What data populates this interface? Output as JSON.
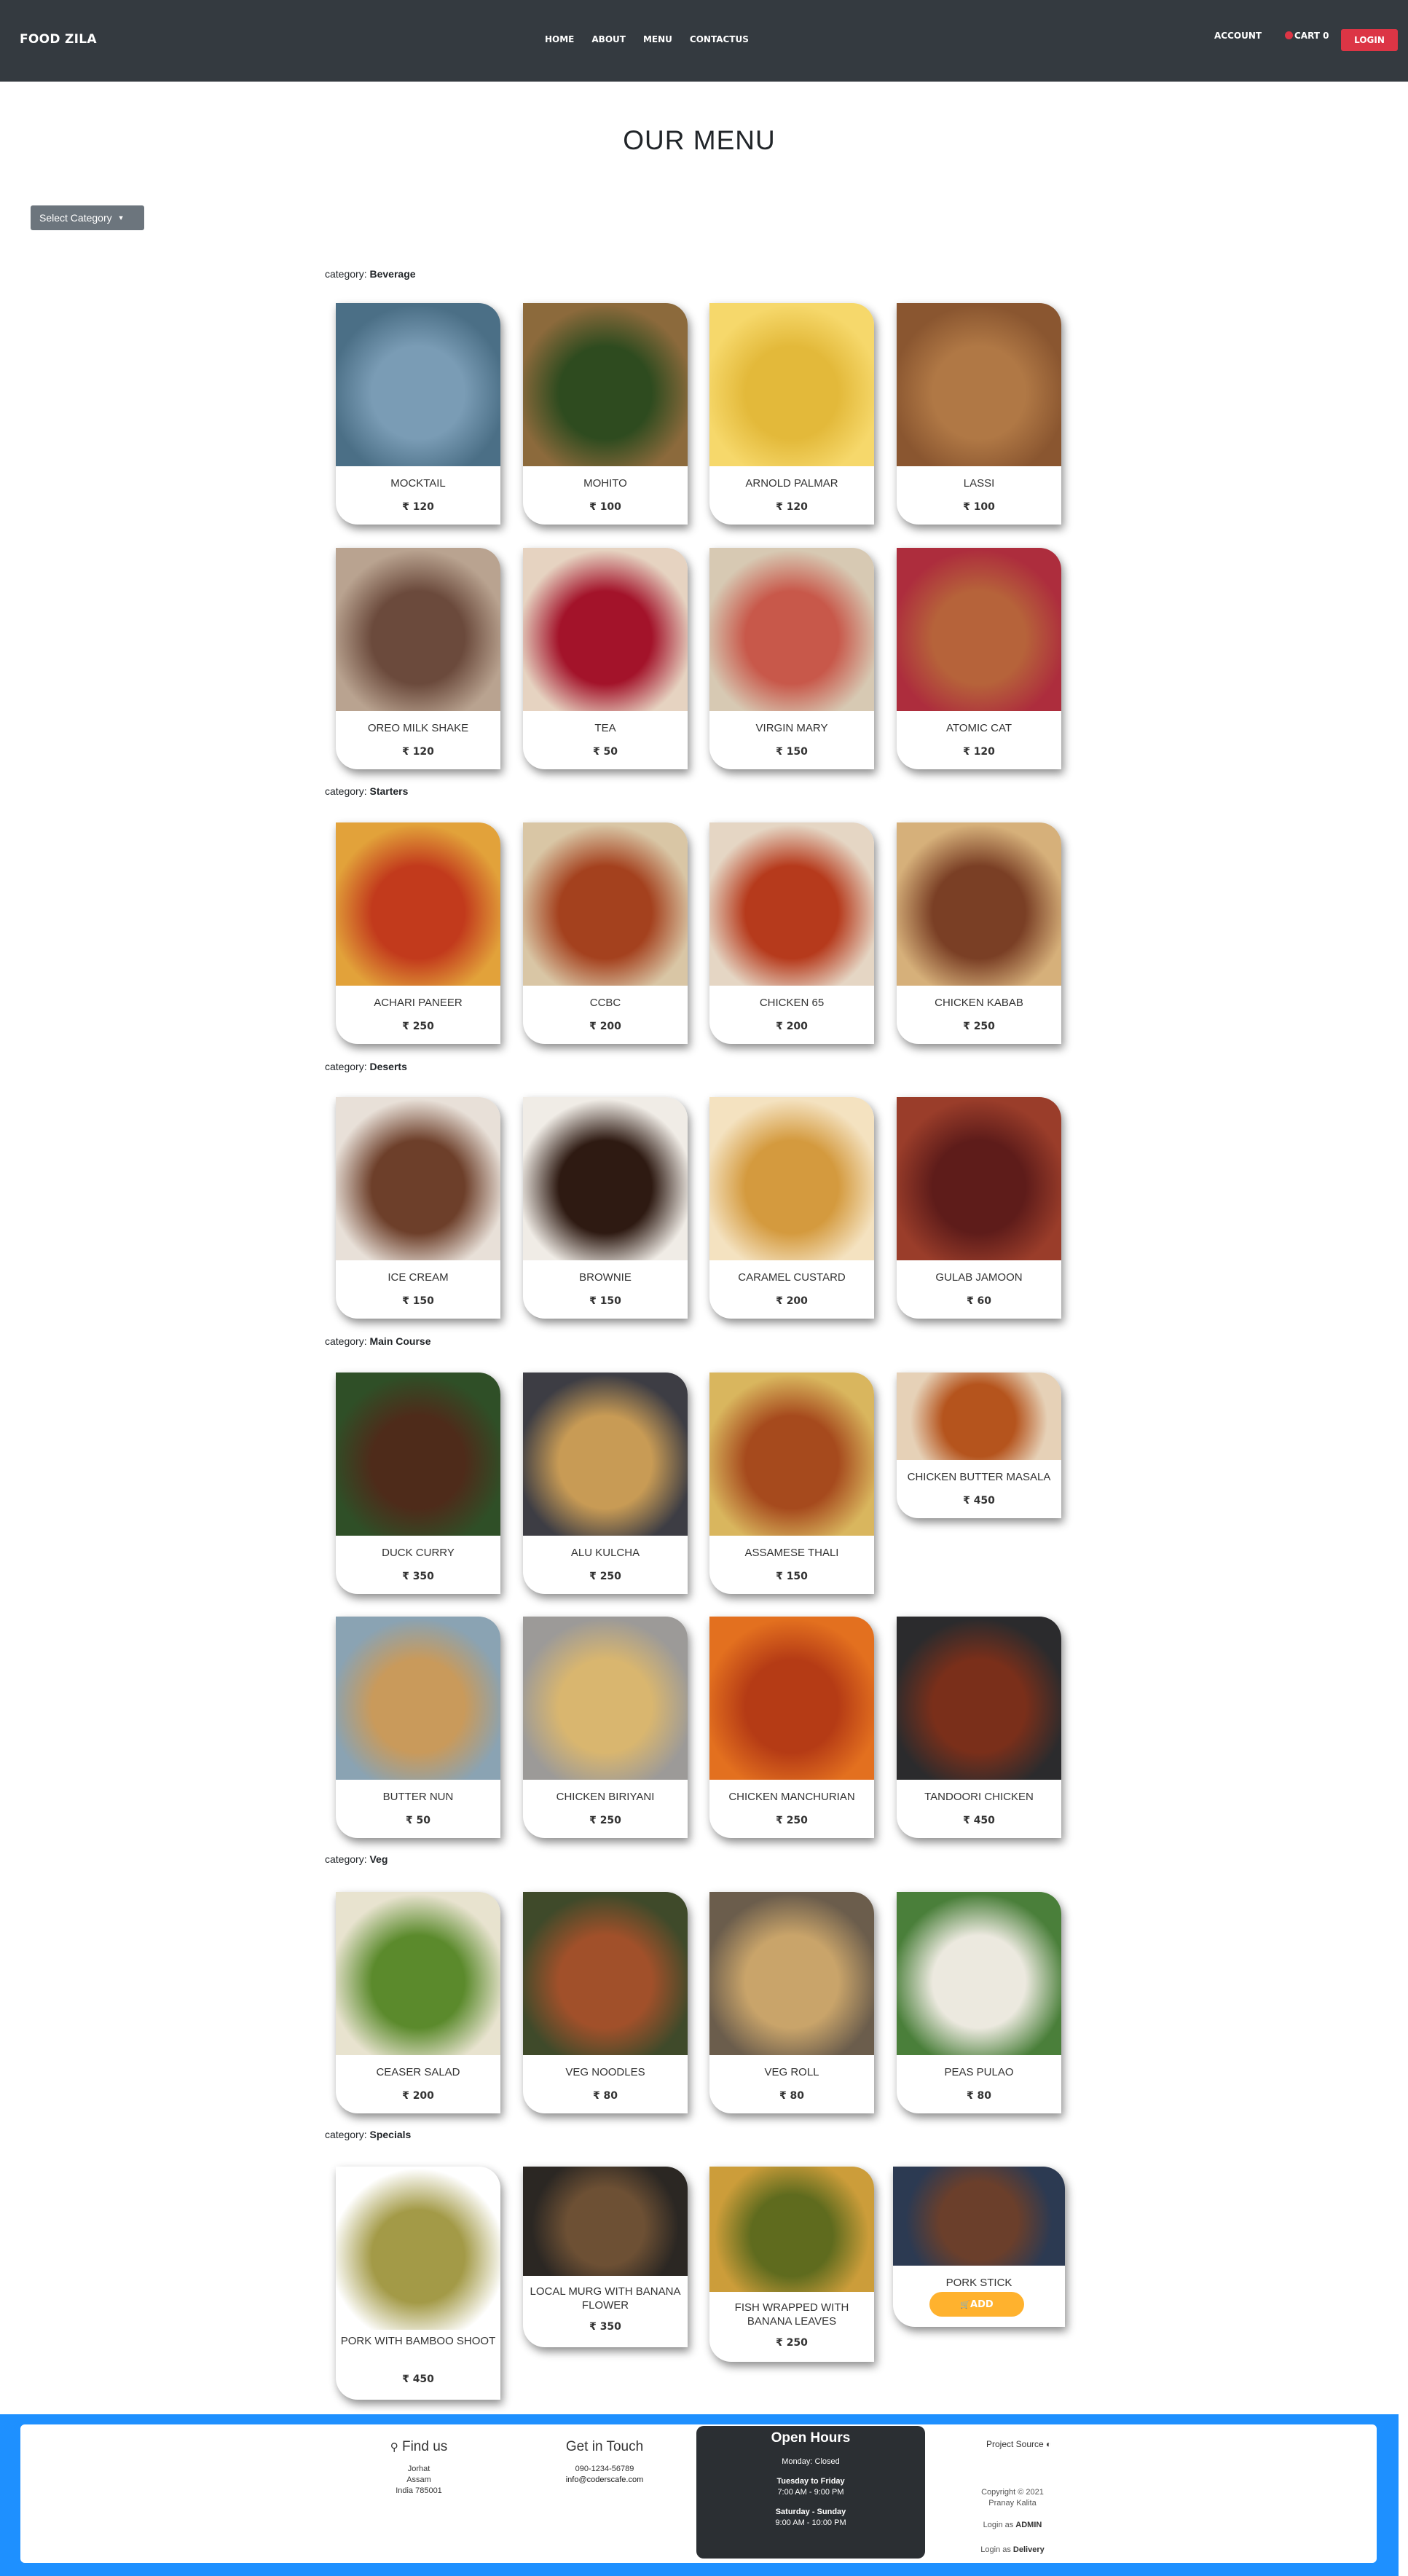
{
  "nav": {
    "brand": "FOOD ZILA",
    "links": [
      "HOME",
      "ABOUT",
      "MENU",
      "CONTACTUS"
    ],
    "account": "ACCOUNT",
    "cart": "CART 0",
    "login": "LOGIN"
  },
  "page_title": "OUR MENU",
  "select_category": "Select Category",
  "category_prefix": "category:",
  "categories": [
    {
      "name": "Beverage",
      "items": [
        {
          "name": "MOCKTAIL",
          "price": "₹ 120"
        },
        {
          "name": "MOHITO",
          "price": "₹ 100"
        },
        {
          "name": "ARNOLD PALMAR",
          "price": "₹ 120"
        },
        {
          "name": "LASSI",
          "price": "₹ 100"
        },
        {
          "name": "OREO MILK SHAKE",
          "price": "₹ 120"
        },
        {
          "name": "TEA",
          "price": "₹ 50"
        },
        {
          "name": "VIRGIN MARY",
          "price": "₹ 150"
        },
        {
          "name": "ATOMIC CAT",
          "price": "₹ 120"
        }
      ]
    },
    {
      "name": "Starters",
      "items": [
        {
          "name": "ACHARI PANEER",
          "price": "₹ 250"
        },
        {
          "name": "CCBC",
          "price": "₹ 200"
        },
        {
          "name": "CHICKEN 65",
          "price": "₹ 200"
        },
        {
          "name": "CHICKEN KABAB",
          "price": "₹ 250"
        }
      ]
    },
    {
      "name": "Deserts",
      "items": [
        {
          "name": "ICE CREAM",
          "price": "₹ 150"
        },
        {
          "name": "BROWNIE",
          "price": "₹ 150"
        },
        {
          "name": "CARAMEL CUSTARD",
          "price": "₹ 200"
        },
        {
          "name": "GULAB JAMOON",
          "price": "₹ 60"
        }
      ]
    },
    {
      "name": "Main Course",
      "items": [
        {
          "name": "DUCK CURRY",
          "price": "₹ 350"
        },
        {
          "name": "ALU KULCHA",
          "price": "₹ 250"
        },
        {
          "name": "ASSAMESE THALI",
          "price": "₹ 150"
        },
        {
          "name": "CHICKEN BUTTER MASALA",
          "price": "₹ 450"
        },
        {
          "name": "BUTTER NUN",
          "price": "₹ 50"
        },
        {
          "name": "CHICKEN BIRIYANI",
          "price": "₹ 250"
        },
        {
          "name": "CHICKEN MANCHURIAN",
          "price": "₹ 250"
        },
        {
          "name": "TANDOORI CHICKEN",
          "price": "₹ 450"
        }
      ]
    },
    {
      "name": "Veg",
      "items": [
        {
          "name": "CEASER SALAD",
          "price": "₹ 200"
        },
        {
          "name": "VEG NOODLES",
          "price": "₹ 80"
        },
        {
          "name": "VEG ROLL",
          "price": "₹ 80"
        },
        {
          "name": "PEAS PULAO",
          "price": "₹ 80"
        }
      ]
    },
    {
      "name": "Specials",
      "items": [
        {
          "name": "PORK WITH BAMBOO SHOOT",
          "price": "₹ 450"
        },
        {
          "name": "LOCAL MURG WITH BANANA FLOWER",
          "price": "₹ 350"
        },
        {
          "name": "FISH WRAPPED WITH BANANA LEAVES",
          "price": "₹ 250"
        },
        {
          "name": "PORK STICK",
          "price": ""
        }
      ]
    }
  ],
  "add_button": "ADD",
  "footer": {
    "find_us": {
      "title": "Find us",
      "lines": [
        "Jorhat",
        "Assam",
        "India 785001"
      ]
    },
    "get_in_touch": {
      "title": "Get in Touch",
      "phone": "090-1234-56789",
      "email": "info@coderscafe.com"
    },
    "open_hours": {
      "title": "Open Hours",
      "monday": "Monday: Closed",
      "weekdays_label": "Tuesday to Friday",
      "weekdays_time": "7:00 AM - 9:00 PM",
      "weekend_label": "Saturday - Sunday",
      "weekend_time": "9:00 AM - 10:00 PM"
    },
    "project_source": "Project Source",
    "copyright": [
      "Copyright © 2021",
      "Pranay Kalita"
    ],
    "login_admin_prefix": "Login as",
    "login_admin": "ADMIN",
    "login_delivery_prefix": "Login as",
    "login_delivery": "Delivery"
  },
  "colors": {
    "navbar": "#343a40",
    "login": "#dc3545",
    "select": "#6c757d",
    "add": "#ffb22e",
    "footer": "#1e90ff",
    "hours_bg": "#2b2f33"
  },
  "icons": [
    "cart-icon",
    "map-marker-icon",
    "github-icon",
    "cart-icon"
  ]
}
